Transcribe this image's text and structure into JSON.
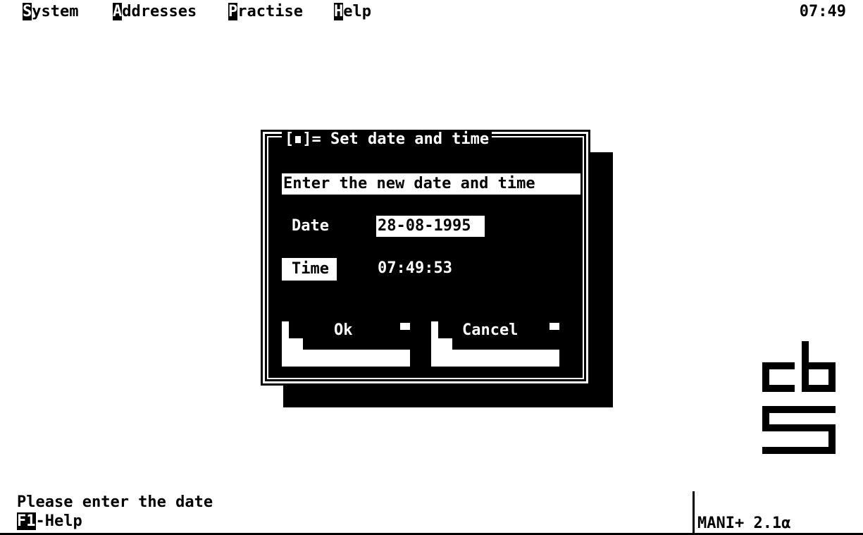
{
  "menu": {
    "items": [
      {
        "hotkey": "S",
        "rest": "ystem"
      },
      {
        "hotkey": "A",
        "rest": "ddresses"
      },
      {
        "hotkey": "P",
        "rest": "ractise"
      },
      {
        "hotkey": "H",
        "rest": "elp"
      }
    ],
    "clock": "07:49"
  },
  "dialog": {
    "close_open": "[",
    "close_close": "]=",
    "title": "Set date and time",
    "prompt": "Enter the new date and time",
    "date_label": "Date",
    "date_value": "28-08-1995",
    "time_label": "Time",
    "time_value": "07:49:53",
    "ok_label": "Ok",
    "cancel_label": "Cancel"
  },
  "status": {
    "message": "Please enter the date",
    "f1_key": "F1",
    "f1_text": "-Help",
    "version": "MANI+ 2.1α"
  },
  "logo": {
    "name": "cbs-logo"
  }
}
